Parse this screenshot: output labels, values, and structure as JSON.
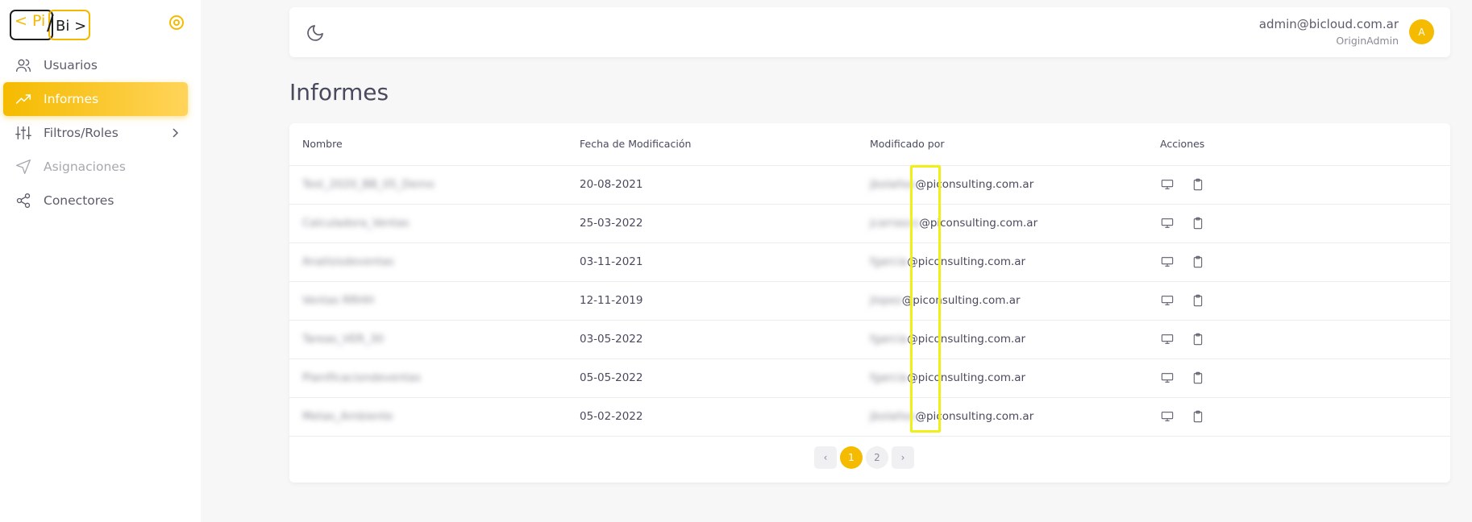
{
  "logo": {
    "left": "< Pi",
    "slash": "/",
    "right": "Bi >"
  },
  "sidebar": {
    "items": [
      {
        "label": "Usuarios",
        "icon": "users-icon"
      },
      {
        "label": "Informes",
        "icon": "trending-up-icon",
        "active": true
      },
      {
        "label": "Filtros/Roles",
        "icon": "sliders-icon",
        "has_submenu": true
      },
      {
        "label": "Asignaciones",
        "icon": "send-icon",
        "disabled": true
      },
      {
        "label": "Conectores",
        "icon": "share-icon"
      }
    ]
  },
  "header": {
    "email": "admin@bicloud.com.ar",
    "role": "OriginAdmin",
    "avatar_initial": "A"
  },
  "page": {
    "title": "Informes"
  },
  "table": {
    "columns": [
      "Nombre",
      "Fecha de Modificación",
      "Modificado por",
      "Acciones"
    ],
    "rows": [
      {
        "name": "Test_2020_BB_05_Demo",
        "date": "20-08-2021",
        "user_hidden": "jbolaños",
        "user_domain": "@piconsulting.com.ar"
      },
      {
        "name": "Calculadora_Ventas",
        "date": "25-03-2022",
        "user_hidden": "jcarrasco",
        "user_domain": "@piconsulting.com.ar"
      },
      {
        "name": "Analisisdeventas",
        "date": "03-11-2021",
        "user_hidden": "fgarcia",
        "user_domain": "@piconsulting.com.ar"
      },
      {
        "name": "Ventas RRHH",
        "date": "12-11-2019",
        "user_hidden": "jlopez",
        "user_domain": "@piconsulting.com.ar"
      },
      {
        "name": "Tareas_VER_30",
        "date": "03-05-2022",
        "user_hidden": "fgarcia",
        "user_domain": "@piconsulting.com.ar"
      },
      {
        "name": "Planificaciondeventas",
        "date": "05-05-2022",
        "user_hidden": "fgarcia",
        "user_domain": "@piconsulting.com.ar"
      },
      {
        "name": "Metas_Ambiente",
        "date": "05-02-2022",
        "user_hidden": "jbolaños",
        "user_domain": "@piconsulting.com.ar"
      }
    ]
  },
  "pagination": {
    "prev": "‹",
    "pages": [
      "1",
      "2"
    ],
    "current": "1",
    "next": "›"
  },
  "colors": {
    "accent": "#f5bb00",
    "highlight": "#f0f016"
  }
}
